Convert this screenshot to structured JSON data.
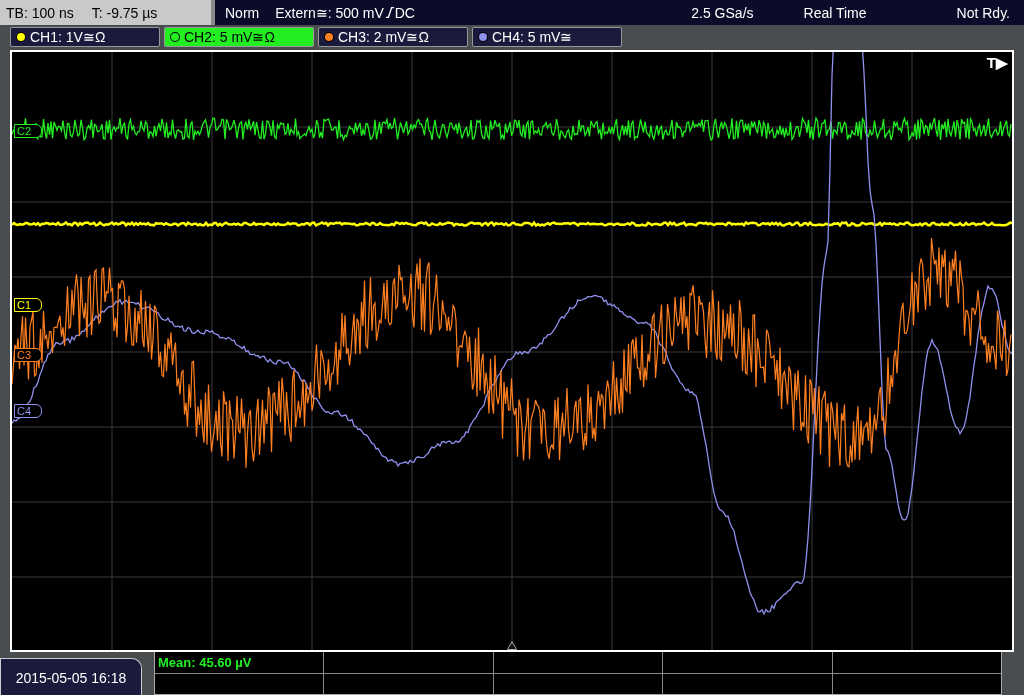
{
  "status_bar": {
    "timebase": "TB: 100 ns",
    "trigger_time": "T: -9.75 µs",
    "mode": "Norm",
    "trigger_source": "Extern≅: 500 mV",
    "trigger_coupling": "DC",
    "sample_rate": "2.5 GSa/s",
    "acquisition": "Real Time",
    "state": "Not Rdy."
  },
  "channels": [
    {
      "label": "CH1: 1V≅Ω",
      "selected": false,
      "color": "#ffff00"
    },
    {
      "label": "CH2: 5 mV≅Ω",
      "selected": true,
      "color": "#22ee22"
    },
    {
      "label": "CH3: 2 mV≅Ω",
      "selected": false,
      "color": "#ff8020"
    },
    {
      "label": "CH4: 5 mV≅",
      "selected": false,
      "color": "#9090ee"
    }
  ],
  "channel_markers": [
    {
      "text": "C2",
      "color": "#22ee22"
    },
    {
      "text": "C1",
      "color": "#ffff00"
    },
    {
      "text": "C3",
      "color": "#ff8020"
    },
    {
      "text": "C4",
      "color": "#9090ee"
    }
  ],
  "trigger_marker": "T▶",
  "date": "2015-05-05 16:18",
  "measurements": [
    {
      "text": "Mean: 45.60 µV"
    }
  ]
}
